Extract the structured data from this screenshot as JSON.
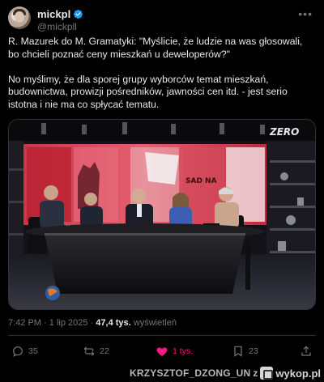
{
  "author": {
    "display_name": "mickpl",
    "handle": "@mickpll",
    "verified": true
  },
  "tweet": {
    "paragraphs": [
      "R. Mazurek do M. Gramatyki: \"Myślicie, że ludzie na was głosowali, bo chcieli poznać ceny mieszkań u deweloperów?\"",
      "No myślimy, że dla sporej grupy wyborców temat mieszkań, budownictwa, prowizji pośredników, jawności cen itd. - jest serio istotna i nie ma co spłycać tematu."
    ]
  },
  "media": {
    "channel_logo": "ZERO",
    "screen_text": "SAD NA"
  },
  "meta": {
    "time": "7:42 PM",
    "date": "1 lip 2025",
    "separator": "·",
    "views_count": "47,4 tys.",
    "views_label": "wyświetleń"
  },
  "actions": {
    "replies": "35",
    "reposts": "22",
    "likes": "1 tys.",
    "bookmarks": "23"
  },
  "watermark": {
    "user": "KRZYSZTOF_DZONG_UN",
    "separator": "z",
    "site": "wykop.pl"
  },
  "colors": {
    "background": "#000000",
    "text": "#e7e9ea",
    "muted": "#71767b",
    "verified": "#1d9bf0",
    "like": "#f91880",
    "divider": "#2f3336"
  }
}
